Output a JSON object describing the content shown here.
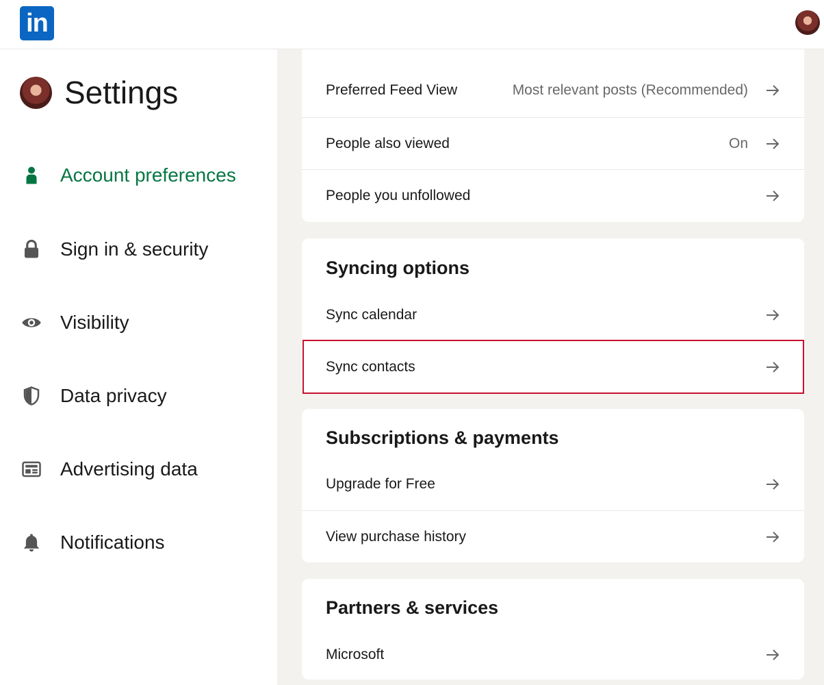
{
  "topbar": {
    "logo_text": "in",
    "logo_icon": "linkedin-logo",
    "avatar_icon": "profile-avatar"
  },
  "sidebar": {
    "title": "Settings",
    "items": [
      {
        "label": "Account preferences",
        "icon": "person-icon",
        "active": true
      },
      {
        "label": "Sign in & security",
        "icon": "lock-icon",
        "active": false
      },
      {
        "label": "Visibility",
        "icon": "eye-icon",
        "active": false
      },
      {
        "label": "Data privacy",
        "icon": "shield-icon",
        "active": false
      },
      {
        "label": "Advertising data",
        "icon": "newspaper-icon",
        "active": false
      },
      {
        "label": "Notifications",
        "icon": "bell-icon",
        "active": false
      }
    ]
  },
  "main": {
    "general_rows": [
      {
        "label": "Preferred Feed View",
        "value": "Most relevant posts (Recommended)"
      },
      {
        "label": "People also viewed",
        "value": "On"
      },
      {
        "label": "People you unfollowed",
        "value": ""
      }
    ],
    "syncing": {
      "title": "Syncing options",
      "rows": [
        {
          "label": "Sync calendar"
        },
        {
          "label": "Sync contacts",
          "highlighted": true
        }
      ]
    },
    "subscriptions": {
      "title": "Subscriptions & payments",
      "rows": [
        {
          "label": "Upgrade for Free"
        },
        {
          "label": "View purchase history"
        }
      ]
    },
    "partners": {
      "title": "Partners & services",
      "rows": [
        {
          "label": "Microsoft"
        }
      ]
    }
  },
  "colors": {
    "accent_green": "#057642",
    "brand_blue": "#0a66c2",
    "highlight_red": "#c8102e",
    "background": "#f4f2ee"
  }
}
